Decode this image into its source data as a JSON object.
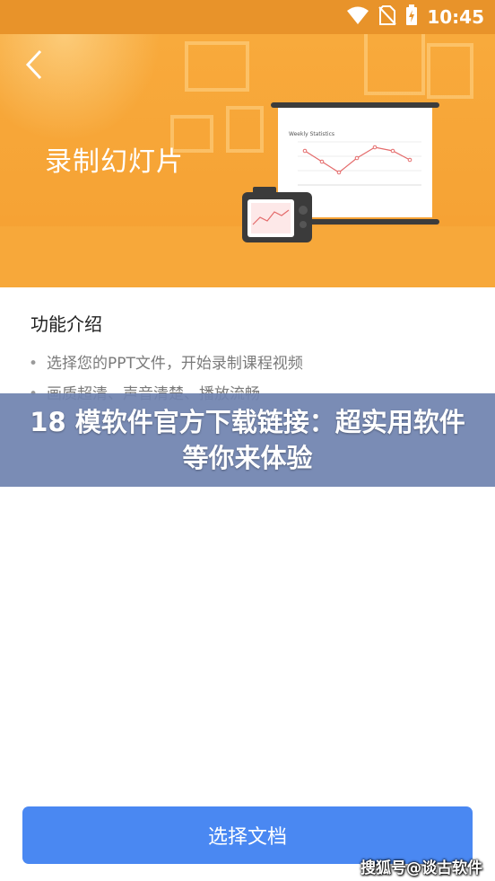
{
  "status_bar": {
    "time": "10:45",
    "icons": [
      "wifi-icon",
      "no-sim-icon",
      "battery-charging-icon"
    ]
  },
  "hero": {
    "title": "录制幻灯片",
    "board_chart_title": "Weekly Statistics",
    "colors": {
      "background": "#f6a335",
      "line": "#e46b6b"
    }
  },
  "content": {
    "section_heading": "功能介绍",
    "features": [
      "选择您的PPT文件，开始录制课程视频",
      "画质超清、声音清楚、播放流畅"
    ]
  },
  "overlay": {
    "text": "18 模软件官方下载链接：超实用软件等你来体验"
  },
  "actions": {
    "primary_label": "选择文档",
    "primary_color": "#4a88f2"
  },
  "watermark": "搜狐号@谈古软件"
}
